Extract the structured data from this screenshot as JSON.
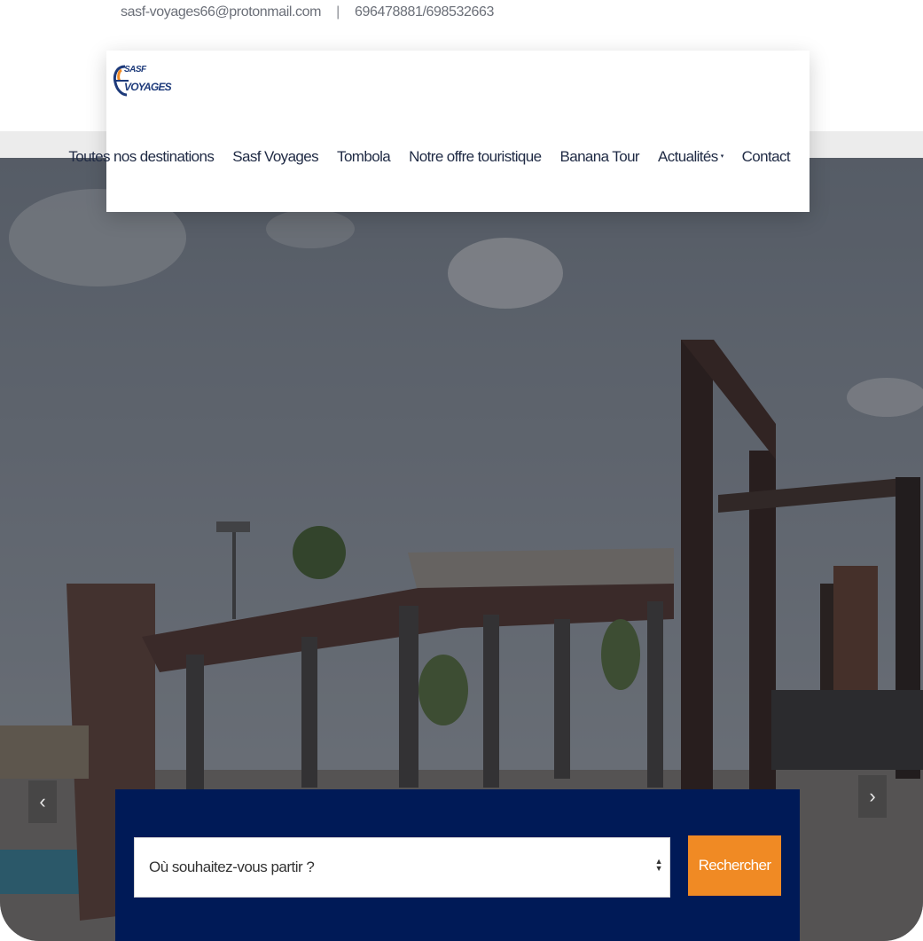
{
  "topbar": {
    "email": "sasf-voyages66@protonmail.com",
    "separator": "|",
    "phone": "696478881/698532663"
  },
  "logo": {
    "line1": "SASF",
    "line2": "VOYAGES"
  },
  "nav": {
    "items": [
      {
        "label": "Toutes nos destinations"
      },
      {
        "label": "Sasf Voyages"
      },
      {
        "label": "Tombola"
      },
      {
        "label": "Notre offre touristique"
      },
      {
        "label": "Banana Tour"
      },
      {
        "label": "Actualités",
        "caret": "▾"
      },
      {
        "label": "Contact"
      }
    ]
  },
  "slider": {
    "prev_icon": "‹",
    "next_icon": "›"
  },
  "search": {
    "placeholder": "Où souhaitez-vous partir ?",
    "button_label": "Rechercher"
  },
  "colors": {
    "panel": "#001a57",
    "button": "#f08a24",
    "nav_text": "#1f2a44"
  }
}
